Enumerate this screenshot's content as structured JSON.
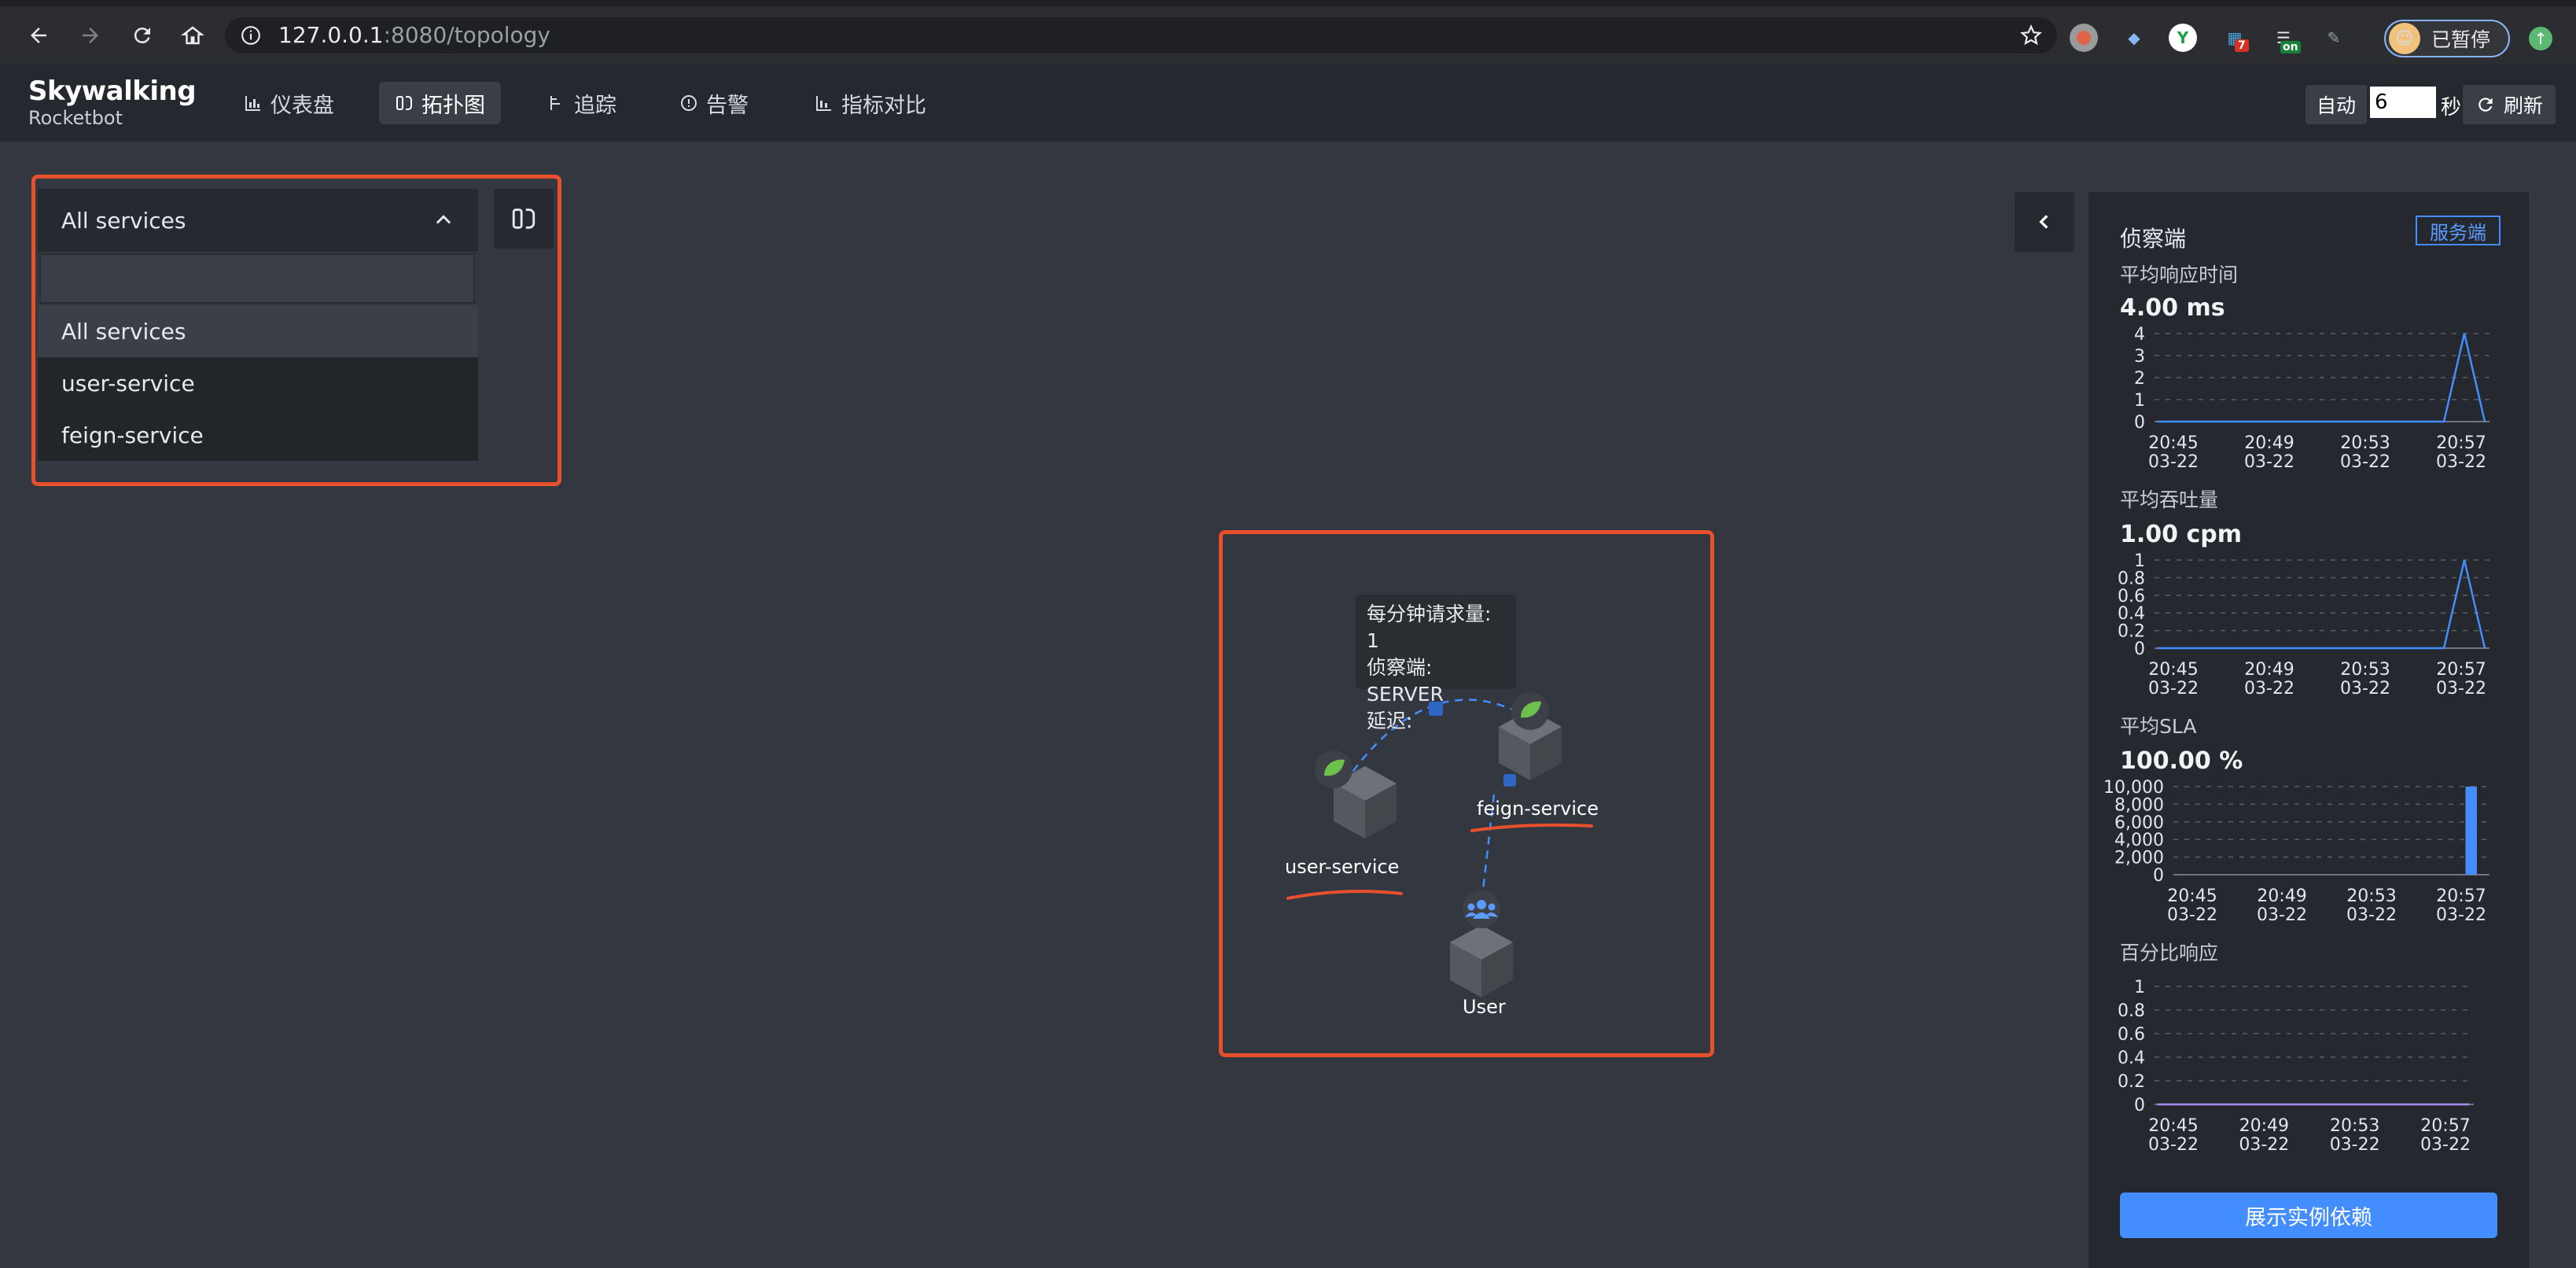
{
  "browser": {
    "url_host": "127.0.0.1",
    "url_rest": ":8080/topology",
    "profile_label": "已暂停",
    "ext_badge_7": "7",
    "ext_badge_on": "on"
  },
  "header": {
    "logo_main": "Skywalking",
    "logo_sub": "Rocketbot",
    "nav": [
      {
        "label": "仪表盘",
        "icon": "bar-chart-icon"
      },
      {
        "label": "拓扑图",
        "icon": "topology-icon",
        "active": true
      },
      {
        "label": "追踪",
        "icon": "trace-icon"
      },
      {
        "label": "告警",
        "icon": "alarm-icon"
      },
      {
        "label": "指标对比",
        "icon": "compare-chart-icon"
      }
    ],
    "auto_label": "自动",
    "interval_value": "6",
    "seconds_label": "秒",
    "refresh_label": "刷新"
  },
  "selector": {
    "current": "All services",
    "search_value": "",
    "options": [
      "All services",
      "user-service",
      "feign-service"
    ]
  },
  "topology": {
    "tooltip": {
      "line1_label": "每分钟请求量:",
      "line1_value": "1",
      "line2_label": "侦察端:",
      "line2_value": "SERVER",
      "line3_label": "延迟:"
    },
    "nodes": [
      {
        "name": "user-service",
        "type": "spring-boot"
      },
      {
        "name": "feign-service",
        "type": "spring-boot"
      },
      {
        "name": "User",
        "type": "user"
      }
    ]
  },
  "panel": {
    "detect_point": "侦察端",
    "server_badge": "服务端",
    "metrics": [
      {
        "title": "平均响应时间",
        "value": "4.00 ms",
        "chart_data": {
          "type": "line",
          "yticks": [
            "4",
            "3",
            "2",
            "1",
            "0"
          ],
          "ylim": [
            0,
            4
          ],
          "x_labels": [
            [
              "20:45",
              "03-22"
            ],
            [
              "20:49",
              "03-22"
            ],
            [
              "20:53",
              "03-22"
            ],
            [
              "20:57",
              "03-22"
            ]
          ],
          "points": [
            0,
            0,
            0,
            0,
            0,
            0,
            0,
            0,
            0,
            0,
            0,
            0,
            0,
            0,
            0,
            4,
            0
          ]
        }
      },
      {
        "title": "平均吞吐量",
        "value": "1.00 cpm",
        "chart_data": {
          "type": "line",
          "yticks": [
            "1",
            "0.8",
            "0.6",
            "0.4",
            "0.2",
            "0"
          ],
          "ylim": [
            0,
            1
          ],
          "x_labels": [
            [
              "20:45",
              "03-22"
            ],
            [
              "20:49",
              "03-22"
            ],
            [
              "20:53",
              "03-22"
            ],
            [
              "20:57",
              "03-22"
            ]
          ],
          "points": [
            0,
            0,
            0,
            0,
            0,
            0,
            0,
            0,
            0,
            0,
            0,
            0,
            0,
            0,
            0,
            1,
            0
          ]
        }
      },
      {
        "title": "平均SLA",
        "value": "100.00 %",
        "chart_data": {
          "type": "bar",
          "yticks": [
            "10,000",
            "8,000",
            "6,000",
            "4,000",
            "2,000",
            "0"
          ],
          "ylim": [
            0,
            10000
          ],
          "x_labels": [
            [
              "20:45",
              "03-22"
            ],
            [
              "20:49",
              "03-22"
            ],
            [
              "20:53",
              "03-22"
            ],
            [
              "20:57",
              "03-22"
            ]
          ],
          "values": [
            0,
            0,
            0,
            0,
            0,
            0,
            0,
            0,
            0,
            0,
            0,
            0,
            0,
            0,
            0,
            10000
          ]
        }
      },
      {
        "title": "百分比响应",
        "value": "",
        "chart_data": {
          "type": "line",
          "yticks": [
            "1",
            "0.8",
            "0.6",
            "0.4",
            "0.2",
            "0"
          ],
          "ylim": [
            0,
            1
          ],
          "x_labels": [
            [
              "20:45",
              "03-22"
            ],
            [
              "20:49",
              "03-22"
            ],
            [
              "20:53",
              "03-22"
            ],
            [
              "20:57",
              "03-22"
            ]
          ],
          "points": [
            0,
            0,
            0,
            0,
            0,
            0,
            0,
            0,
            0,
            0,
            0,
            0,
            0,
            0,
            0,
            0,
            0
          ]
        }
      }
    ],
    "instance_button": "展示实例依赖"
  },
  "colors": {
    "accent": "#448dfe",
    "highlight": "#e84f2b",
    "line": "#448dfe",
    "spring": "#6cc24a"
  }
}
